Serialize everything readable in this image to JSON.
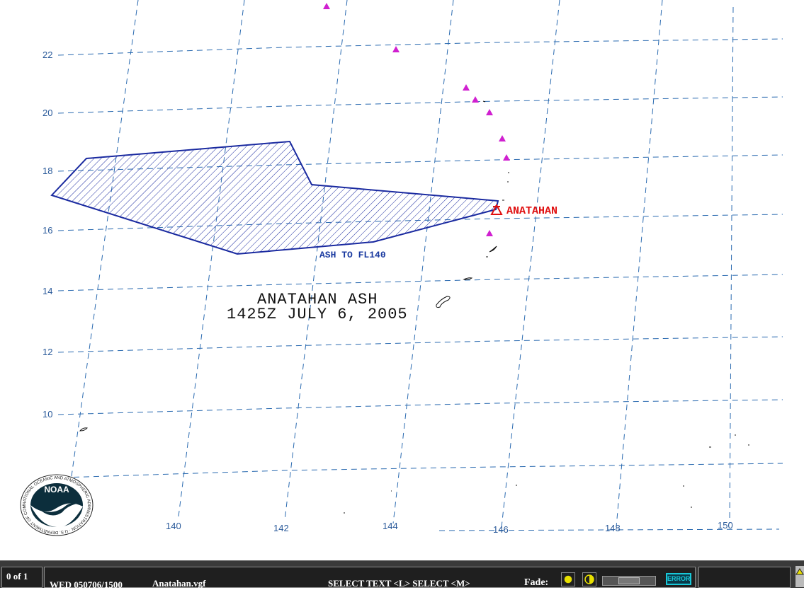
{
  "map": {
    "title_line1": "ANATAHAN ASH",
    "title_line2": "1425Z JULY 6, 2005",
    "ash_label": "ASH TO FL140",
    "volcano_name": "ANATAHAN",
    "lat_labels": [
      "22",
      "20",
      "18",
      "16",
      "14",
      "12",
      "10"
    ],
    "lon_labels": [
      "140",
      "142",
      "144",
      "146",
      "148",
      "150"
    ],
    "colors": {
      "grid": "#2a6ab0",
      "ash_polygon": "#1a2aa0",
      "volcano": "#e01010",
      "volcano_markers": "#d020d0"
    },
    "logo": {
      "name": "NOAA",
      "ring_text": "NATIONAL OCEANIC AND ATMOSPHERIC ADMINISTRATION · U.S. DEPARTMENT OF COMMERCE"
    }
  },
  "statusbar": {
    "frame_counter": "0 of 1",
    "datetime": "WED 050706/1500",
    "filename": "Anatahan.vgf",
    "mouse_hint": "SELECT TEXT   <L> SELECT  <M>",
    "fade_label": "Fade:",
    "error_button": "ERROR"
  }
}
